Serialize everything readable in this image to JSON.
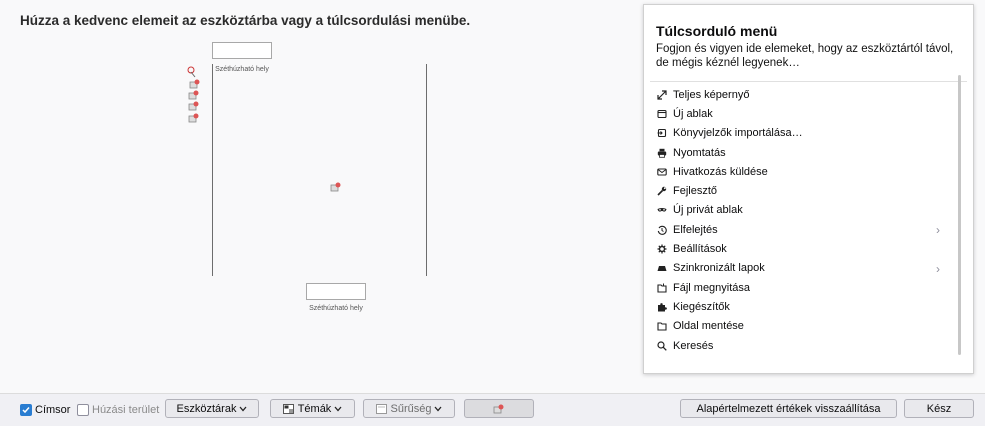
{
  "heading": "Húzza a kedvenc elemeit az eszköztárba vagy a túlcsordulási menübe.",
  "palette": {
    "spring_label_top": "Széthúzható hely",
    "spring_label_bottom": "Széthúzható hely"
  },
  "overflow_panel": {
    "title": "Túlcsorduló menü",
    "description": "Fogjon és vigyen ide elemeket, hogy az eszköztártól távol, de mégis kéznél legyenek…",
    "items": [
      {
        "label": "Teljes képernyő",
        "icon": "fullscreen-icon"
      },
      {
        "label": "Új ablak",
        "icon": "new-window-icon"
      },
      {
        "label": "Könyvjelzők importálása…",
        "icon": "import-icon"
      },
      {
        "label": "Nyomtatás",
        "icon": "print-icon"
      },
      {
        "label": "Hivatkozás küldése",
        "icon": "email-icon"
      },
      {
        "label": "Fejlesztő",
        "icon": "wrench-icon"
      },
      {
        "label": "Új privát ablak",
        "icon": "private-mask-icon"
      },
      {
        "label": "Elfelejtés",
        "icon": "forget-icon",
        "submenu": true
      },
      {
        "label": "Beállítások",
        "icon": "gear-icon"
      },
      {
        "label": "Szinkronizált lapok",
        "icon": "synced-tabs-icon",
        "submenu": true
      },
      {
        "label": "Fájl megnyitása",
        "icon": "open-file-icon"
      },
      {
        "label": "Kiegészítők",
        "icon": "puzzle-icon"
      },
      {
        "label": "Oldal mentése",
        "icon": "save-page-icon"
      },
      {
        "label": "Keresés",
        "icon": "search-icon"
      }
    ]
  },
  "footer": {
    "title_bar_label": "Címsor",
    "title_bar_checked": true,
    "drag_space_label": "Húzási terület",
    "drag_space_checked": false,
    "toolbars_label": "Eszköztárak",
    "themes_label": "Témák",
    "density_label": "Sűrűség",
    "restore_label": "Alapértelmezett értékek visszaállítása",
    "done_label": "Kész"
  }
}
